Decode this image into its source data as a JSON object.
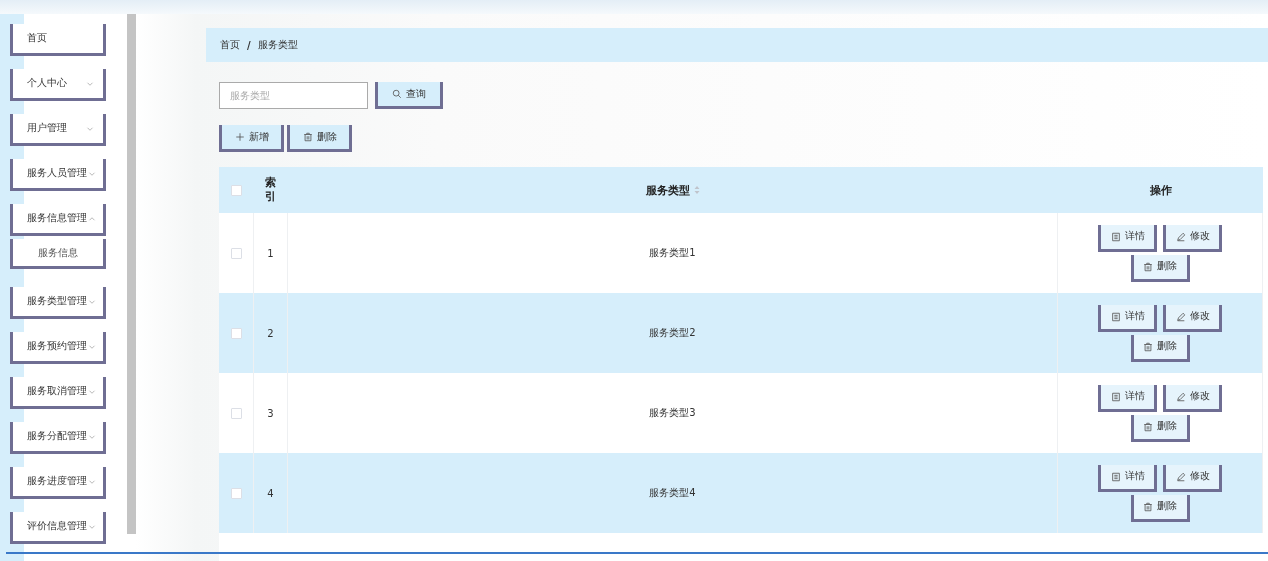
{
  "sidebar": {
    "items": [
      {
        "label": "首页"
      },
      {
        "label": "个人中心",
        "expanded": false
      },
      {
        "label": "用户管理",
        "expanded": false
      },
      {
        "label": "服务人员管理",
        "expanded": false
      },
      {
        "label": "服务信息管理",
        "expanded": true,
        "children": [
          {
            "label": "服务信息"
          }
        ]
      },
      {
        "label": "服务类型管理",
        "expanded": false
      },
      {
        "label": "服务预约管理",
        "expanded": false
      },
      {
        "label": "服务取消管理",
        "expanded": false
      },
      {
        "label": "服务分配管理",
        "expanded": false
      },
      {
        "label": "服务进度管理",
        "expanded": false
      },
      {
        "label": "评价信息管理",
        "expanded": false
      }
    ]
  },
  "breadcrumb": [
    "首页",
    "服务类型"
  ],
  "breadcrumb_separator": "/",
  "search": {
    "placeholder": "服务类型",
    "button": "查询"
  },
  "actions": [
    {
      "kind": "add",
      "label": "新增"
    },
    {
      "kind": "delete",
      "label": "删除"
    }
  ],
  "table": {
    "columns": [
      "索引",
      "服务类型",
      "操作"
    ],
    "all_checked": false,
    "rows": [
      {
        "checked": false,
        "index": "1",
        "type": "服务类型1",
        "buttons": [
          {
            "kind": "detail",
            "label": "详情"
          },
          {
            "kind": "edit",
            "label": "修改"
          },
          {
            "kind": "delete",
            "label": "删除"
          }
        ]
      },
      {
        "checked": false,
        "index": "2",
        "type": "服务类型2",
        "buttons": [
          {
            "kind": "detail",
            "label": "详情"
          },
          {
            "kind": "edit",
            "label": "修改"
          },
          {
            "kind": "delete",
            "label": "删除"
          }
        ]
      },
      {
        "checked": false,
        "index": "3",
        "type": "服务类型3",
        "buttons": [
          {
            "kind": "detail",
            "label": "详情"
          },
          {
            "kind": "edit",
            "label": "修改"
          },
          {
            "kind": "delete",
            "label": "删除"
          }
        ]
      },
      {
        "checked": false,
        "index": "4",
        "type": "服务类型4",
        "buttons": [
          {
            "kind": "detail",
            "label": "详情"
          },
          {
            "kind": "edit",
            "label": "修改"
          },
          {
            "kind": "delete",
            "label": "删除"
          }
        ]
      }
    ]
  }
}
